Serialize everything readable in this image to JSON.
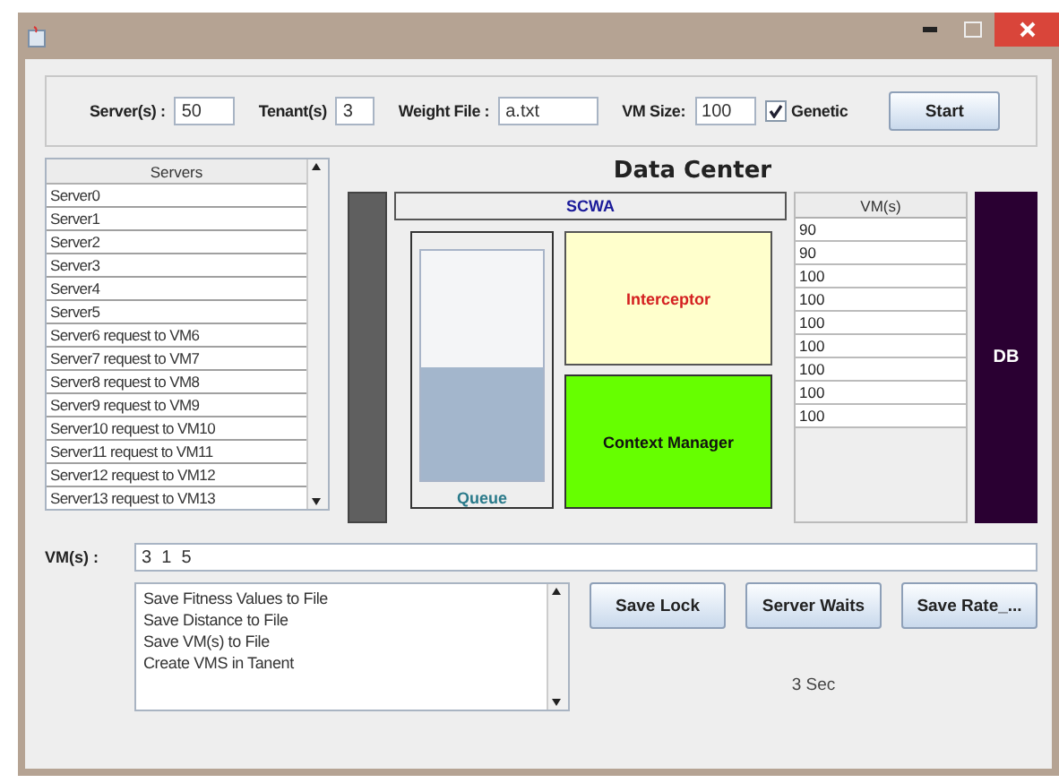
{
  "toolbar": {
    "fields": [
      {
        "label": "Server(s) :",
        "value": "50"
      },
      {
        "label": "Tenant(s)",
        "value": "3"
      },
      {
        "label": "Weight File :",
        "value": "a.txt"
      },
      {
        "label": "VM Size:",
        "value": "100"
      }
    ],
    "genetic": {
      "label": "Genetic",
      "checked": true
    },
    "start_button": "Start"
  },
  "servers": {
    "heading": "Servers",
    "items": [
      "Server0",
      "Server1",
      "Server2",
      "Server3",
      "Server4",
      "Server5",
      "Server6 request to VM6",
      "Server7 request to VM7",
      "Server8 request to VM8",
      "Server9 request to VM9",
      "Server10 request to VM10",
      "Server11 request to VM11",
      "Server12 request to VM12",
      "Server13 request to VM13"
    ]
  },
  "data_center": {
    "title": "Data Center",
    "scwa": "SCWA",
    "queue": {
      "label": "Queue",
      "level": 0.49
    },
    "interceptor": "Interceptor",
    "context_manager": "Context Manager",
    "vms": {
      "heading": "VM(s)",
      "items": [
        "90",
        "90",
        "100",
        "100",
        "100",
        "100",
        "100",
        "100",
        "100"
      ]
    },
    "db": "DB"
  },
  "vm_input": {
    "label": "VM(s) :",
    "value": "3  1  5"
  },
  "log": [
    "Save Fitness Values to File",
    "Save Distance to File",
    "Save VM(s) to File",
    "Create VMS in Tanent"
  ],
  "buttons": [
    "Save Lock",
    "Server Waits",
    "Save Rate_..."
  ],
  "timer": "3 Sec"
}
